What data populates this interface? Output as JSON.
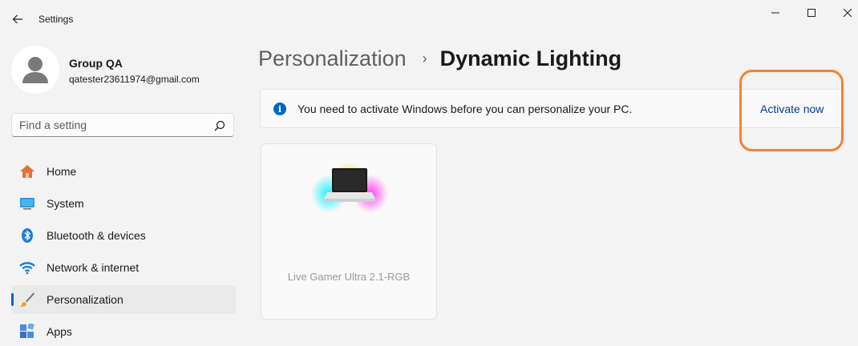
{
  "window": {
    "title": "Settings"
  },
  "profile": {
    "name": "Group QA",
    "email": "qatester23611974@gmail.com"
  },
  "search": {
    "placeholder": "Find a setting"
  },
  "sidebar": {
    "items": [
      {
        "label": "Home",
        "icon": "home-icon"
      },
      {
        "label": "System",
        "icon": "system-icon"
      },
      {
        "label": "Bluetooth & devices",
        "icon": "bluetooth-icon"
      },
      {
        "label": "Network & internet",
        "icon": "wifi-icon"
      },
      {
        "label": "Personalization",
        "icon": "brush-icon",
        "active": true
      },
      {
        "label": "Apps",
        "icon": "apps-icon"
      }
    ]
  },
  "breadcrumb": {
    "parent": "Personalization",
    "separator": "›",
    "current": "Dynamic Lighting"
  },
  "banner": {
    "message": "You need to activate Windows before you can personalize your PC.",
    "action": "Activate now",
    "icon": "info-icon"
  },
  "device": {
    "name": "Live Gamer Ultra 2.1-RGB"
  },
  "colors": {
    "accent": "#0067c0",
    "link": "#003e92",
    "highlight": "#f5822e"
  }
}
